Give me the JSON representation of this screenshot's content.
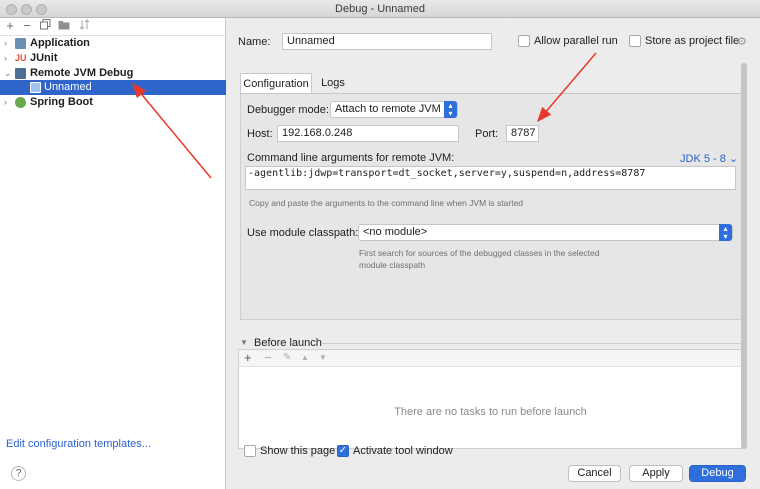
{
  "window": {
    "title": "Debug - Unnamed"
  },
  "left": {
    "tree": [
      {
        "label": "Application",
        "icon": "application-config-icon",
        "expanded": false
      },
      {
        "label": "JUnit",
        "icon": "junit-icon",
        "expanded": false
      },
      {
        "label": "Remote JVM Debug",
        "icon": "remote-debug-icon",
        "expanded": true
      },
      {
        "label": "Unnamed",
        "icon": "remote-debug-icon",
        "selected": true
      },
      {
        "label": "Spring Boot",
        "icon": "spring-boot-icon",
        "expanded": false
      }
    ],
    "edit_templates": "Edit configuration templates...",
    "help_label": "?"
  },
  "header": {
    "name_label": "Name:",
    "name_value": "Unnamed",
    "allow_parallel_label": "Allow parallel run",
    "allow_parallel_checked": false,
    "store_project_label": "Store as project file",
    "store_project_checked": false
  },
  "tabs": [
    {
      "label": "Configuration",
      "active": true
    },
    {
      "label": "Logs",
      "active": false
    }
  ],
  "config": {
    "debugger_mode_label": "Debugger mode:",
    "debugger_mode_value": "Attach to remote JVM",
    "host_label": "Host:",
    "host_value": "192.168.0.248",
    "port_label": "Port:",
    "port_value": "8787",
    "cmdline_label": "Command line arguments for remote JVM:",
    "jdk_label": "JDK 5 - 8",
    "cmdline_value": "-agentlib:jdwp=transport=dt_socket,server=y,suspend=n,address=8787",
    "cmdline_hint": "Copy and paste the arguments to the command line when JVM is started",
    "module_label": "Use module classpath:",
    "module_value": "<no module>",
    "module_hint_1": "First search for sources of the debugged classes in the selected",
    "module_hint_2": "module classpath"
  },
  "before_launch": {
    "label": "Before launch",
    "empty_text": "There are no tasks to run before launch"
  },
  "footer": {
    "show_page_label": "Show this page",
    "show_page_checked": false,
    "activate_tool_label": "Activate tool window",
    "activate_tool_checked": true,
    "cancel_label": "Cancel",
    "apply_label": "Apply",
    "debug_label": "Debug"
  },
  "colors": {
    "accent": "#2f6fdd",
    "selection": "#2f65ca",
    "annotation_arrow": "#e8392d",
    "link": "#2a62c9"
  }
}
